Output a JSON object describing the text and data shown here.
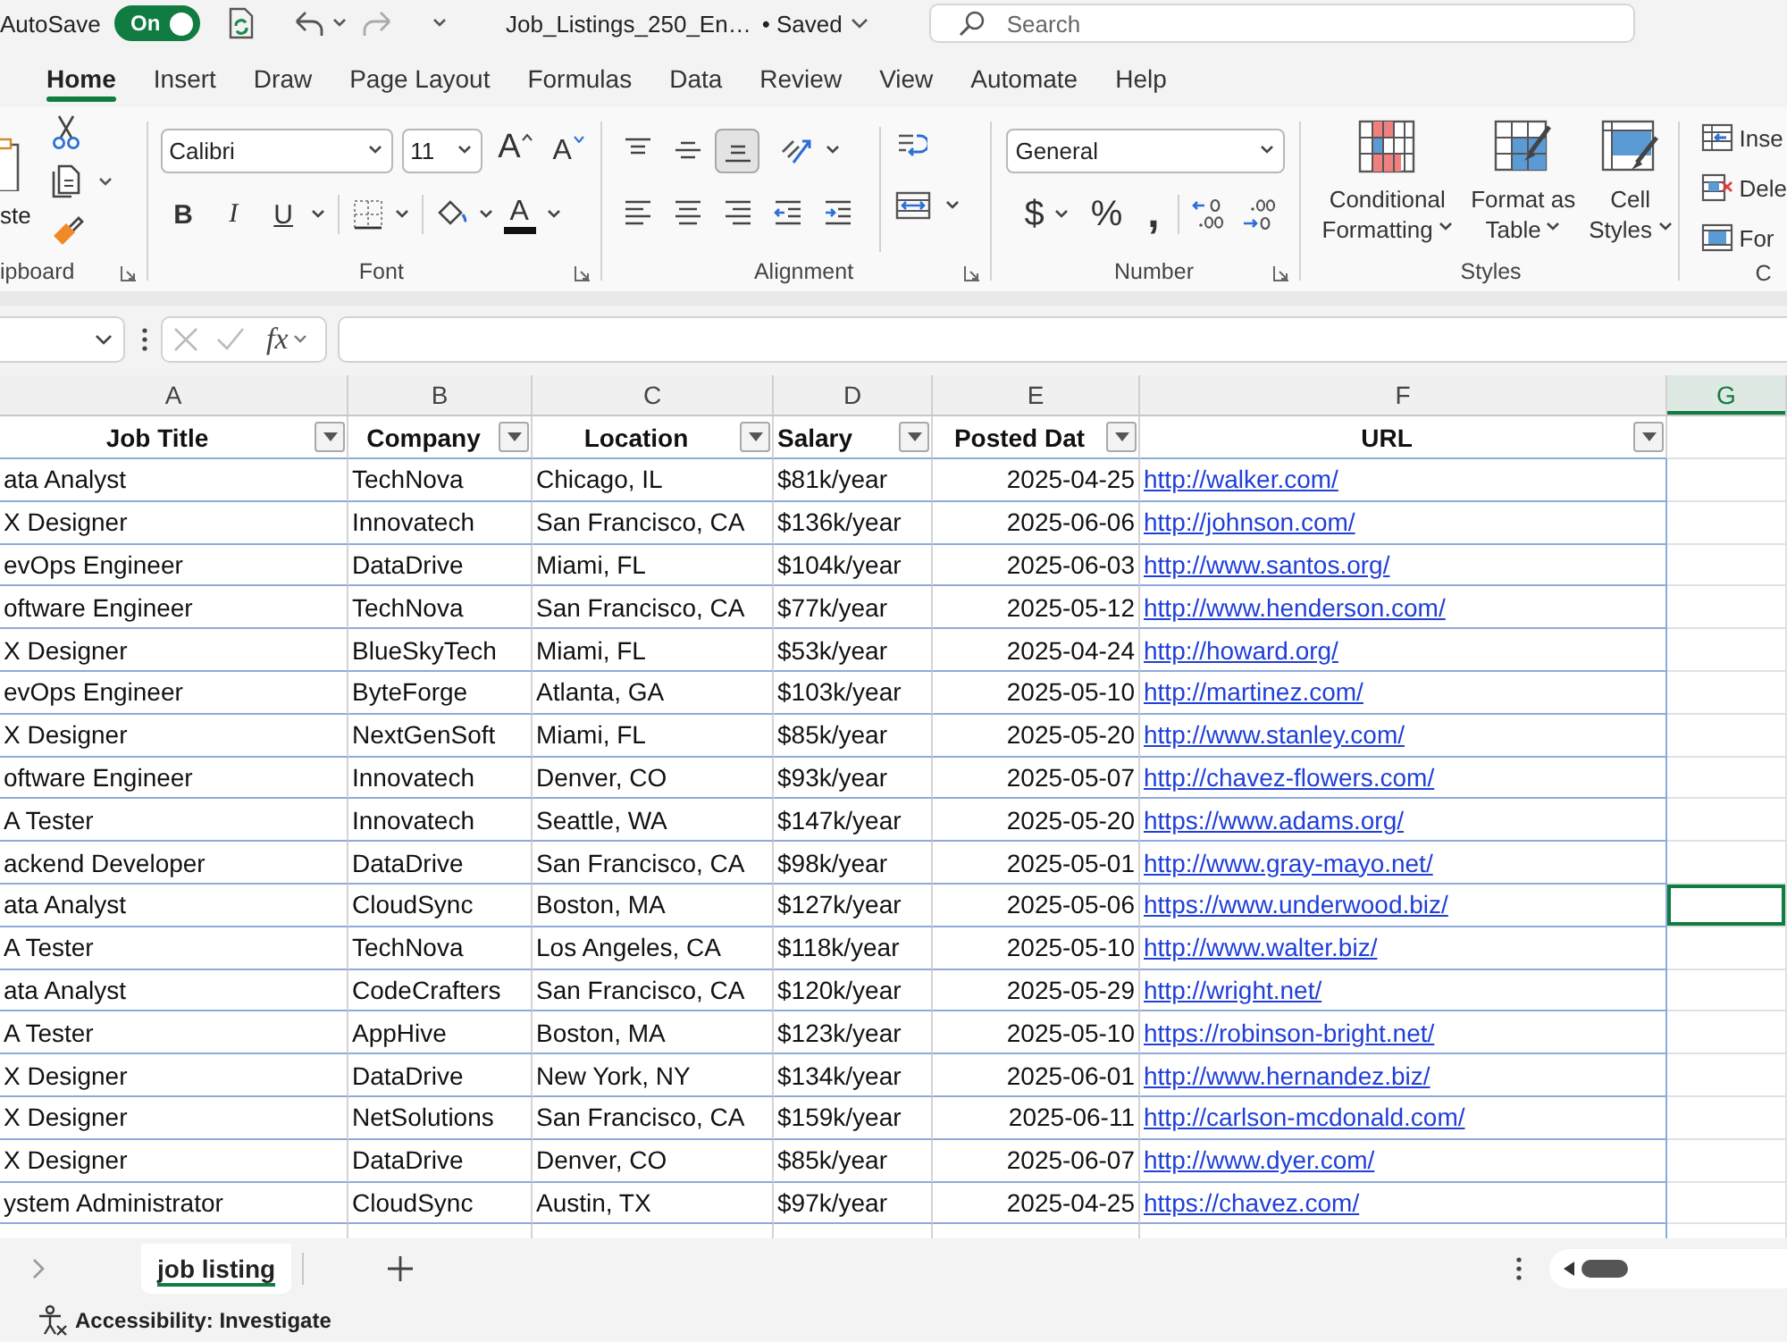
{
  "title_bar": {
    "autosave_label": "AutoSave",
    "autosave_toggle": {
      "label": "On",
      "on": true
    },
    "document_name": "Job_Listings_250_En…",
    "save_status": "• Saved",
    "search": {
      "placeholder": "Search"
    }
  },
  "ribbon_tabs": [
    {
      "label": "Home",
      "selected": true
    },
    {
      "label": "Insert",
      "selected": false
    },
    {
      "label": "Draw",
      "selected": false
    },
    {
      "label": "Page Layout",
      "selected": false
    },
    {
      "label": "Formulas",
      "selected": false
    },
    {
      "label": "Data",
      "selected": false
    },
    {
      "label": "Review",
      "selected": false
    },
    {
      "label": "View",
      "selected": false
    },
    {
      "label": "Automate",
      "selected": false
    },
    {
      "label": "Help",
      "selected": false
    }
  ],
  "ribbon": {
    "clipboard": {
      "paste_label": "ste",
      "group_label": "ipboard"
    },
    "font": {
      "font_name": "Calibri",
      "font_size": "11",
      "grow_label": "A",
      "shrink_label": "A",
      "styles": [
        {
          "kind": "bold",
          "label": "B"
        },
        {
          "kind": "italic",
          "label": "I"
        },
        {
          "kind": "underline",
          "label": "U"
        }
      ],
      "font_color_label": "A",
      "group_label": "Font"
    },
    "alignment": {
      "vertical": [
        {
          "kind": "top",
          "on": false
        },
        {
          "kind": "middle",
          "on": false
        },
        {
          "kind": "bottom",
          "on": true
        }
      ],
      "horizontal": [
        {
          "kind": "left"
        },
        {
          "kind": "center"
        },
        {
          "kind": "right"
        },
        {
          "kind": "indent_decrease"
        },
        {
          "kind": "indent_increase"
        }
      ],
      "group_label": "Alignment"
    },
    "number": {
      "format": "General",
      "currency": "$",
      "percent": "%",
      "comma": ",",
      "group_label": "Number"
    },
    "styles": {
      "buttons": [
        {
          "kind": "conditional",
          "label": "Conditional Formatting"
        },
        {
          "kind": "table",
          "label": "Format as Table"
        },
        {
          "kind": "cell",
          "label": "Cell Styles"
        }
      ],
      "group_label": "Styles"
    },
    "cells": {
      "buttons": [
        {
          "kind": "insert",
          "label": "Inse"
        },
        {
          "kind": "delete",
          "label": "Dele"
        },
        {
          "kind": "format",
          "label": "For"
        }
      ],
      "group_label": "C"
    }
  },
  "formula_bar": {
    "fx_label": "fx"
  },
  "column_headers": [
    {
      "label": "A",
      "selected": false
    },
    {
      "label": "B",
      "selected": false
    },
    {
      "label": "C",
      "selected": false
    },
    {
      "label": "D",
      "selected": false
    },
    {
      "label": "E",
      "selected": false
    },
    {
      "label": "F",
      "selected": false
    },
    {
      "label": "G",
      "selected": true
    }
  ],
  "table": {
    "columns": [
      "Job Title",
      "Company",
      "Location",
      "Salary",
      "Posted Dat",
      "URL"
    ],
    "rows": [
      {
        "cells": [
          "ata Analyst",
          "TechNova",
          "Chicago, IL",
          "$81k/year",
          "2025-04-25",
          "http://walker.com/"
        ],
        "selected": false
      },
      {
        "cells": [
          "X Designer",
          "Innovatech",
          "San Francisco, CA",
          "$136k/year",
          "2025-06-06",
          "http://johnson.com/"
        ],
        "selected": false
      },
      {
        "cells": [
          "evOps Engineer",
          "DataDrive",
          "Miami, FL",
          "$104k/year",
          "2025-06-03",
          "http://www.santos.org/"
        ],
        "selected": false
      },
      {
        "cells": [
          "oftware Engineer",
          "TechNova",
          "San Francisco, CA",
          "$77k/year",
          "2025-05-12",
          "http://www.henderson.com/"
        ],
        "selected": false
      },
      {
        "cells": [
          "X Designer",
          "BlueSkyTech",
          "Miami, FL",
          "$53k/year",
          "2025-04-24",
          "http://howard.org/"
        ],
        "selected": false
      },
      {
        "cells": [
          "evOps Engineer",
          "ByteForge",
          "Atlanta, GA",
          "$103k/year",
          "2025-05-10",
          "http://martinez.com/"
        ],
        "selected": false
      },
      {
        "cells": [
          "X Designer",
          "NextGenSoft",
          "Miami, FL",
          "$85k/year",
          "2025-05-20",
          "http://www.stanley.com/"
        ],
        "selected": false
      },
      {
        "cells": [
          "oftware Engineer",
          "Innovatech",
          "Denver, CO",
          "$93k/year",
          "2025-05-07",
          "http://chavez-flowers.com/"
        ],
        "selected": false
      },
      {
        "cells": [
          "A Tester",
          "Innovatech",
          "Seattle, WA",
          "$147k/year",
          "2025-05-20",
          "https://www.adams.org/"
        ],
        "selected": false
      },
      {
        "cells": [
          "ackend Developer",
          "DataDrive",
          "San Francisco, CA",
          "$98k/year",
          "2025-05-01",
          "http://www.gray-mayo.net/"
        ],
        "selected": false
      },
      {
        "cells": [
          "ata Analyst",
          "CloudSync",
          "Boston, MA",
          "$127k/year",
          "2025-05-06",
          "https://www.underwood.biz/"
        ],
        "selected": true
      },
      {
        "cells": [
          "A Tester",
          "TechNova",
          "Los Angeles, CA",
          "$118k/year",
          "2025-05-10",
          "http://www.walter.biz/"
        ],
        "selected": false
      },
      {
        "cells": [
          "ata Analyst",
          "CodeCrafters",
          "San Francisco, CA",
          "$120k/year",
          "2025-05-29",
          "http://wright.net/"
        ],
        "selected": false
      },
      {
        "cells": [
          "A Tester",
          "AppHive",
          "Boston, MA",
          "$123k/year",
          "2025-05-10",
          "https://robinson-bright.net/"
        ],
        "selected": false
      },
      {
        "cells": [
          "X Designer",
          "DataDrive",
          "New York, NY",
          "$134k/year",
          "2025-06-01",
          "http://www.hernandez.biz/"
        ],
        "selected": false
      },
      {
        "cells": [
          "X Designer",
          "NetSolutions",
          "San Francisco, CA",
          "$159k/year",
          "2025-06-11",
          "http://carlson-mcdonald.com/"
        ],
        "selected": false
      },
      {
        "cells": [
          "X Designer",
          "DataDrive",
          "Denver, CO",
          "$85k/year",
          "2025-06-07",
          "http://www.dyer.com/"
        ],
        "selected": false
      },
      {
        "cells": [
          "ystem Administrator",
          "CloudSync",
          "Austin, TX",
          "$97k/year",
          "2025-04-25",
          "https://chavez.com/"
        ],
        "selected": false
      }
    ]
  },
  "sheet_tabs": [
    {
      "label": "job listing",
      "selected": true
    }
  ],
  "status_bar": {
    "accessibility": "Accessibility: Investigate"
  }
}
